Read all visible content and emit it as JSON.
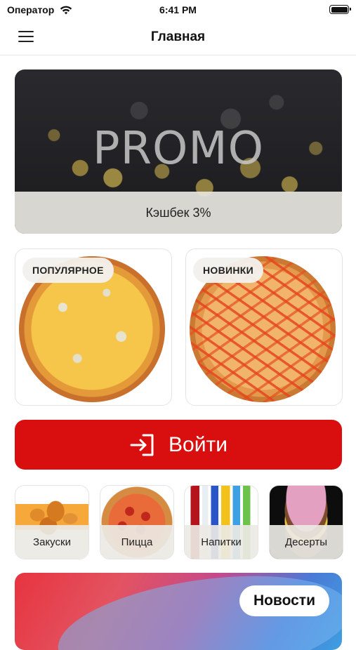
{
  "status_bar": {
    "carrier": "Оператор",
    "time": "6:41 PM"
  },
  "nav": {
    "title": "Главная",
    "menu_icon": "hamburger-menu-icon"
  },
  "promo": {
    "headline": "PROMO",
    "caption": "Кэшбек 3%"
  },
  "categories": [
    {
      "label": "ПОПУЛЯРНОЕ"
    },
    {
      "label": "НОВИНКИ"
    }
  ],
  "login": {
    "label": "Войти",
    "icon": "login-icon"
  },
  "mini_categories": [
    {
      "label": "Закуски"
    },
    {
      "label": "Пицца"
    },
    {
      "label": "Напитки"
    },
    {
      "label": "Десерты"
    }
  ],
  "news": {
    "label": "Новости"
  },
  "colors": {
    "accent": "#d90f0f",
    "background": "#ffffff"
  }
}
